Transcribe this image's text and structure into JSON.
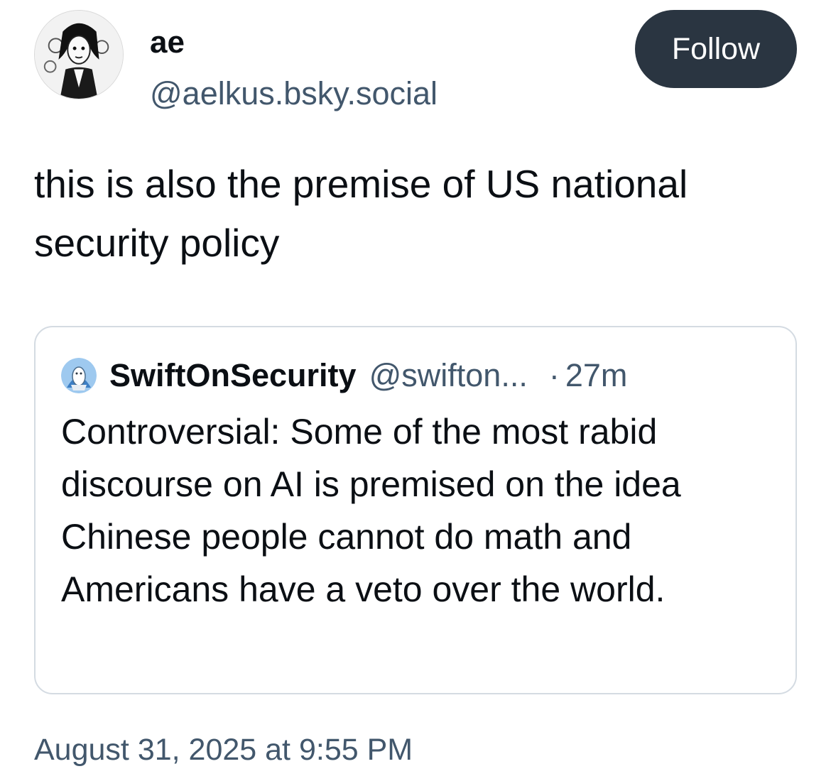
{
  "author": {
    "display_name": "ae",
    "handle": "@aelkus.bsky.social",
    "avatar_icon": "user-avatar-illustration"
  },
  "follow_button": {
    "label": "Follow",
    "color": "#2a3541"
  },
  "post": {
    "text": "this is also the premise of US national security policy",
    "timestamp": "August 31, 2025 at 9:55 PM"
  },
  "quote": {
    "avatar_icon": "quoted-user-avatar",
    "display_name": "SwiftOnSecurity",
    "handle": "@swifton...",
    "separator": "·",
    "relative_time": "27m",
    "text": "Controversial: Some of the most rabid discourse on AI is premised on the idea Chinese people cannot do math and Americans have a veto over the world."
  },
  "colors": {
    "text_primary": "#0b0f14",
    "text_secondary": "#42576c",
    "card_border": "#d4dbe2"
  }
}
